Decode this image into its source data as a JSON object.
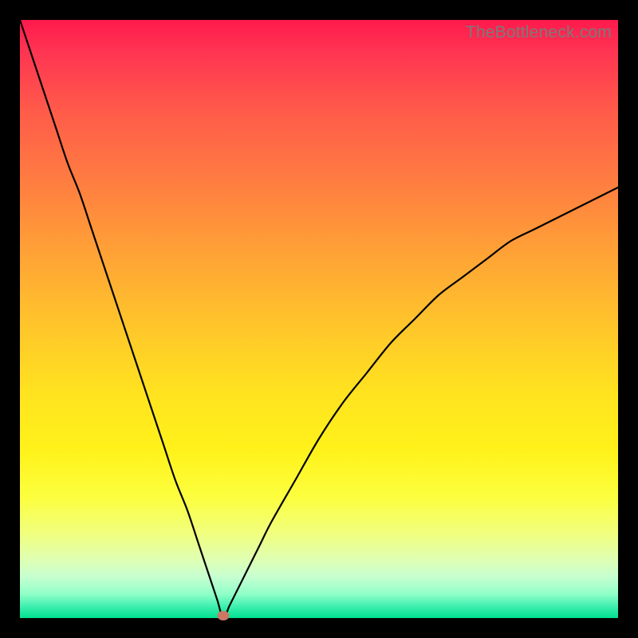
{
  "watermark": "TheBottleneck.com",
  "colors": {
    "frame": "#000000",
    "gradient_top": "#ff1a4d",
    "gradient_mid": "#ffd020",
    "gradient_bottom": "#00e090",
    "curve": "#000000",
    "marker": "#cc7766"
  },
  "chart_data": {
    "type": "line",
    "title": "",
    "xlabel": "",
    "ylabel": "",
    "xlim": [
      0,
      100
    ],
    "ylim": [
      0,
      100
    ],
    "note": "Values are read as fractions of the plot area: x is horizontal position (0=left,100=right), y is bottleneck percentage (0=none at bottom, 100=severe at top). Curve forms a V with minimum at x≈34 where y=0.",
    "x": [
      0,
      2,
      4,
      6,
      8,
      10,
      12,
      14,
      16,
      18,
      20,
      22,
      24,
      26,
      28,
      30,
      32,
      33,
      34,
      35,
      36,
      38,
      40,
      42,
      46,
      50,
      54,
      58,
      62,
      66,
      70,
      74,
      78,
      82,
      86,
      90,
      94,
      98,
      100
    ],
    "y": [
      100,
      94,
      88,
      82,
      76,
      71,
      65,
      59,
      53,
      47,
      41,
      35,
      29,
      23,
      18,
      12,
      6,
      3,
      0,
      2,
      4,
      8,
      12,
      16,
      23,
      30,
      36,
      41,
      46,
      50,
      54,
      57,
      60,
      63,
      65,
      67,
      69,
      71,
      72
    ],
    "marker": {
      "x": 34,
      "y": 0
    }
  }
}
